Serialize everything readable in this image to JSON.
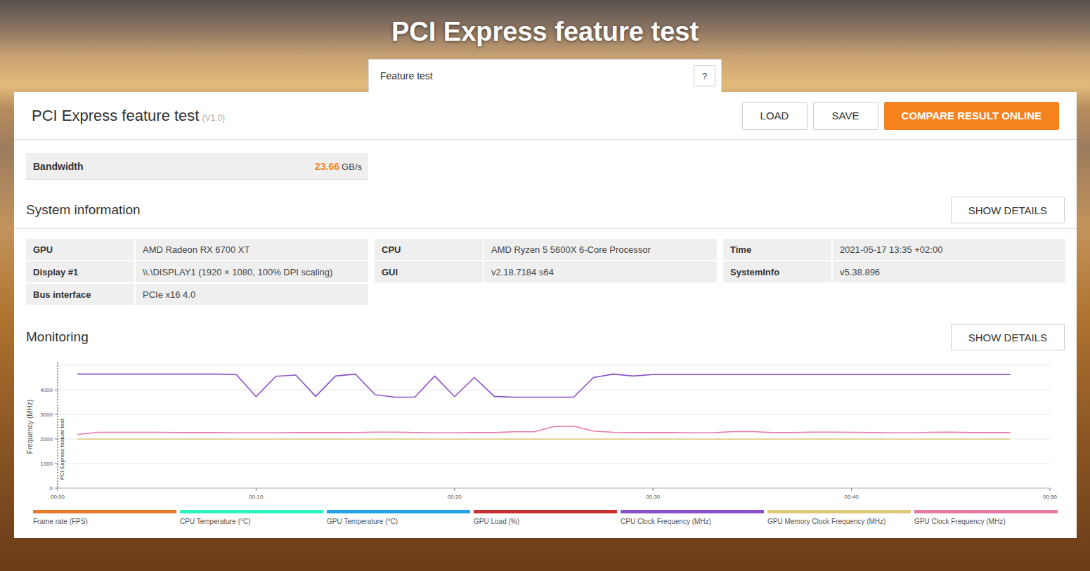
{
  "page": {
    "title": "PCI Express feature test"
  },
  "tab": {
    "label": "Feature test",
    "help": "?"
  },
  "result": {
    "title": "PCI Express feature test",
    "version": "(V1.0)",
    "buttons": [
      {
        "label": "LOAD",
        "kind": "plain"
      },
      {
        "label": "SAVE",
        "kind": "plain"
      },
      {
        "label": "COMPARE RESULT ONLINE",
        "kind": "primary"
      }
    ]
  },
  "score": {
    "label": "Bandwidth",
    "value": "23.66",
    "unit": "GB/s"
  },
  "system_info": {
    "title": "System information",
    "button": "SHOW DETAILS",
    "columns": [
      [
        {
          "key": "GPU",
          "value": "AMD Radeon RX 6700 XT"
        },
        {
          "key": "Display #1",
          "value": "\\\\.\\DISPLAY1 (1920 × 1080, 100% DPI scaling)"
        },
        {
          "key": "Bus interface",
          "value": "PCIe x16 4.0"
        }
      ],
      [
        {
          "key": "CPU",
          "value": "AMD Ryzen 5 5600X 6-Core Processor"
        },
        {
          "key": "GUI",
          "value": "v2.18.7184 s64"
        }
      ],
      [
        {
          "key": "Time",
          "value": "2021-05-17 13:35 +02:00"
        },
        {
          "key": "SystemInfo",
          "value": "v5.38.896"
        }
      ]
    ]
  },
  "monitoring": {
    "title": "Monitoring",
    "button": "SHOW DETAILS",
    "chart": {
      "y_label": "Frequency (MHz)",
      "y_ticks": [
        "0",
        "1000",
        "2000",
        "3000",
        "4000"
      ],
      "x_ticks": [
        "00:00",
        "00:10",
        "00:20",
        "00:30",
        "00:40",
        "00:50"
      ],
      "marker": "PCI Express feature test",
      "series": [
        {
          "name": "Frame rate (FPS)",
          "color": "#e8792b",
          "values": []
        },
        {
          "name": "CPU Temperature (°C)",
          "color": "#2df5c0",
          "values": []
        },
        {
          "name": "GPU Temperature (°C)",
          "color": "#22a3e6",
          "values": []
        },
        {
          "name": "GPU Load (%)",
          "color": "#c7302f",
          "values": []
        },
        {
          "name": "CPU Clock Frequency (MHz)",
          "color": "#8b4fc9",
          "values": [
            4640,
            4640,
            4640,
            4640,
            4640,
            4640,
            4640,
            4640,
            4620,
            3720,
            4550,
            4600,
            3730,
            4560,
            4640,
            3800,
            3700,
            3700,
            4560,
            3720,
            4500,
            3730,
            3700,
            3700,
            3700,
            3700,
            4500,
            4640,
            4560,
            4620,
            4620,
            4620,
            4620,
            4620,
            4620,
            4620,
            4620,
            4620,
            4620,
            4620,
            4620,
            4620,
            4620,
            4620,
            4620,
            4620,
            4620,
            4620
          ]
        },
        {
          "name": "GPU Memory Clock Frequency (MHz)",
          "color": "#e0c87a",
          "values": [
            1990,
            1990,
            1990,
            1990,
            1990,
            1990,
            1990,
            1990,
            1990,
            1990,
            1990,
            1990,
            1990,
            1990,
            1990,
            1990,
            1990,
            1990,
            1990,
            1990,
            1990,
            1990,
            1990,
            1990,
            1990,
            1990,
            1990,
            1990,
            1990,
            1990,
            1990,
            1990,
            1990,
            1990,
            1990,
            1990,
            1990,
            1990,
            1990,
            1990,
            1990,
            1990,
            1990,
            1990,
            1990,
            1990,
            1990,
            1990
          ]
        },
        {
          "name": "GPU Clock Frequency (MHz)",
          "color": "#e57aa6",
          "values": [
            2180,
            2270,
            2270,
            2270,
            2270,
            2260,
            2260,
            2260,
            2250,
            2250,
            2250,
            2260,
            2260,
            2260,
            2260,
            2280,
            2280,
            2260,
            2250,
            2250,
            2260,
            2260,
            2290,
            2290,
            2500,
            2520,
            2320,
            2270,
            2260,
            2260,
            2260,
            2250,
            2250,
            2300,
            2300,
            2260,
            2260,
            2280,
            2280,
            2270,
            2260,
            2250,
            2250,
            2270,
            2280,
            2260,
            2260,
            2260
          ]
        }
      ]
    }
  }
}
